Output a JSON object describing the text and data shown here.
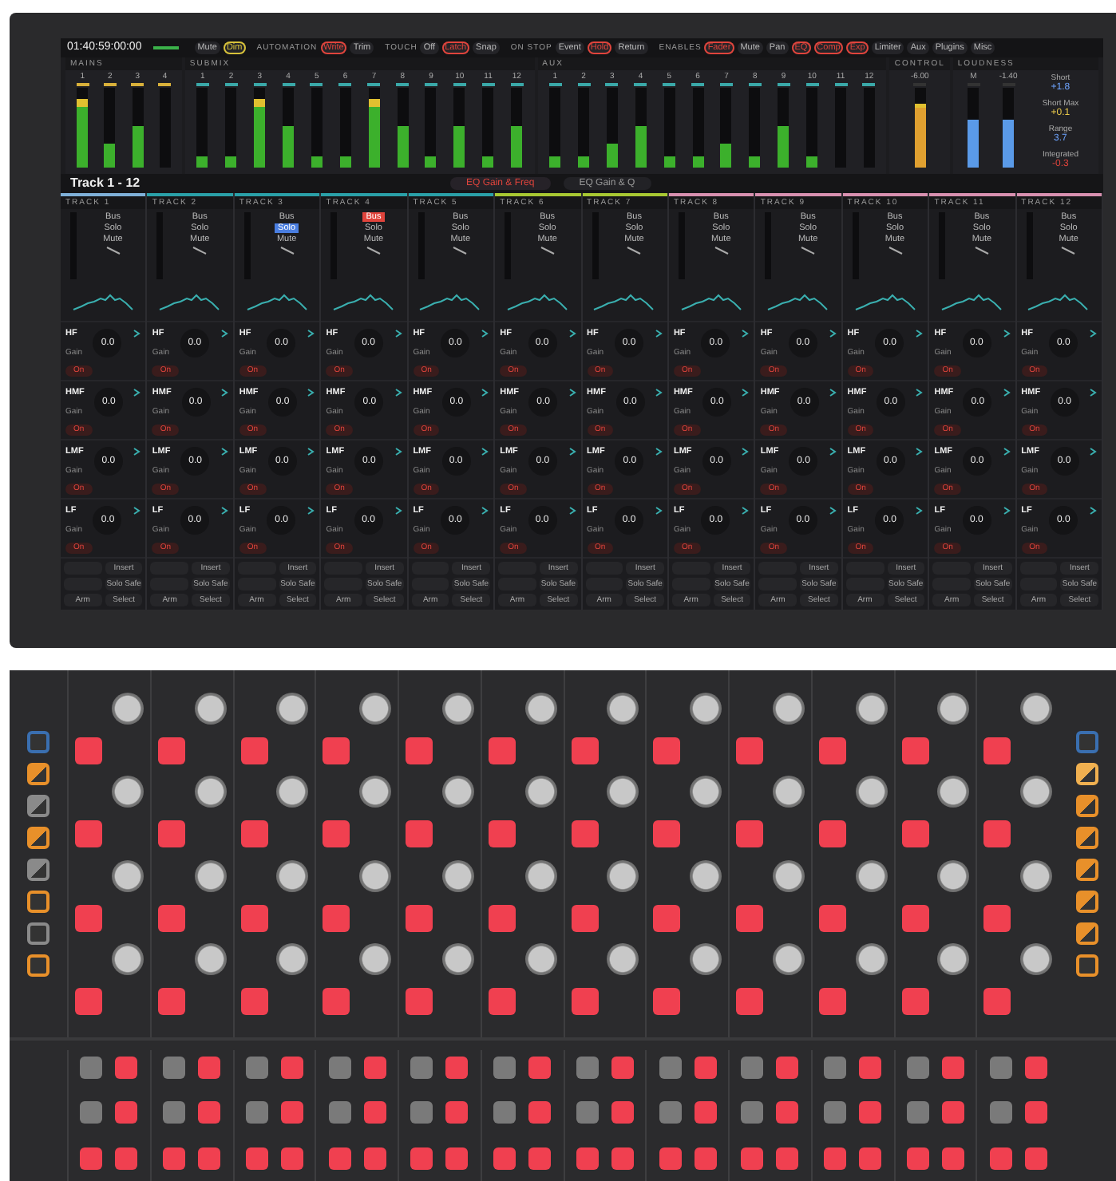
{
  "header": {
    "timecode": "01:40:59:00:00",
    "groups": [
      {
        "color": "#d8c23a",
        "options": [
          {
            "label": "Mute",
            "on": false
          },
          {
            "label": "Dim",
            "on": true
          }
        ]
      },
      {
        "title": "AUTOMATION",
        "color": "#e0443c",
        "options": [
          {
            "label": "Write",
            "on": true
          },
          {
            "label": "Trim",
            "on": false
          }
        ]
      },
      {
        "title": "TOUCH",
        "color": "#e0443c",
        "options": [
          {
            "label": "Off",
            "on": false
          },
          {
            "label": "Latch",
            "on": true
          },
          {
            "label": "Snap",
            "on": false
          }
        ]
      },
      {
        "title": "ON STOP",
        "color": "#e0443c",
        "options": [
          {
            "label": "Event",
            "on": false
          },
          {
            "label": "Hold",
            "on": true
          },
          {
            "label": "Return",
            "on": false
          }
        ]
      },
      {
        "title": "ENABLES",
        "color": "#e0443c",
        "options": [
          {
            "label": "Fader",
            "on": true
          },
          {
            "label": "Mute",
            "on": false
          },
          {
            "label": "Pan",
            "on": false
          },
          {
            "label": "EQ",
            "on": true
          },
          {
            "label": "Comp",
            "on": true
          },
          {
            "label": "Exp",
            "on": true
          },
          {
            "label": "Limiter",
            "on": false
          },
          {
            "label": "Aux",
            "on": false
          },
          {
            "label": "Plugins",
            "on": false
          },
          {
            "label": "Misc",
            "on": false
          }
        ]
      }
    ]
  },
  "meters": {
    "sections": [
      {
        "title": "MAINS",
        "color": "#d8b03a",
        "meters": [
          {
            "label": "1",
            "level": 0.85
          },
          {
            "label": "2",
            "level": 0.3
          },
          {
            "label": "3",
            "level": 0.52
          },
          {
            "label": "4",
            "level": 0.0
          }
        ]
      },
      {
        "title": "SUBMIX",
        "color": "#3aa8a8",
        "meters": [
          {
            "label": "1",
            "level": 0.13
          },
          {
            "label": "2",
            "level": 0.14
          },
          {
            "label": "3",
            "level": 0.85
          },
          {
            "label": "4",
            "level": 0.52
          },
          {
            "label": "5",
            "level": 0.13
          },
          {
            "label": "6",
            "level": 0.13
          },
          {
            "label": "7",
            "level": 0.85
          },
          {
            "label": "8",
            "level": 0.52
          },
          {
            "label": "9",
            "level": 0.13
          },
          {
            "label": "10",
            "level": 0.52
          },
          {
            "label": "11",
            "level": 0.13
          },
          {
            "label": "12",
            "level": 0.52
          }
        ]
      },
      {
        "title": "AUX",
        "color": "#3aa8a8",
        "meters": [
          {
            "label": "1",
            "level": 0.13
          },
          {
            "label": "2",
            "level": 0.13
          },
          {
            "label": "3",
            "level": 0.3
          },
          {
            "label": "4",
            "level": 0.52
          },
          {
            "label": "5",
            "level": 0.13
          },
          {
            "label": "6",
            "level": 0.13
          },
          {
            "label": "7",
            "level": 0.3
          },
          {
            "label": "8",
            "level": 0.13
          },
          {
            "label": "9",
            "level": 0.52
          },
          {
            "label": "10",
            "level": 0.13
          },
          {
            "label": "11",
            "level": 0.0
          },
          {
            "label": "12",
            "level": 0.0
          }
        ]
      }
    ],
    "control": {
      "title": "CONTROL",
      "label": "-6.00",
      "level": 0.8
    },
    "loudness": {
      "title": "LOUDNESS",
      "meters": [
        {
          "label": "M",
          "level": 0.6
        },
        {
          "label": "-1.40",
          "level": 0.6
        }
      ],
      "readings": [
        {
          "label": "Short",
          "value": "+1.8",
          "color": "#6ea4ff"
        },
        {
          "label": "Short Max",
          "value": "+0.1",
          "color": "#e8c84a"
        },
        {
          "label": "Range",
          "value": "3.7",
          "color": "#6ea4ff"
        },
        {
          "label": "Integrated",
          "value": "-0.3",
          "color": "#e0443c"
        }
      ]
    }
  },
  "bank": {
    "title": "Track 1 - 12",
    "tabs": [
      {
        "label": "EQ Gain & Freq",
        "selected": true
      },
      {
        "label": "EQ Gain & Q",
        "selected": false
      }
    ]
  },
  "tracks": [
    {
      "name": "TRACK 1",
      "color": "#7fb0d8",
      "buttons": [
        {
          "label": "Bus",
          "on": false
        },
        {
          "label": "Solo",
          "on": false
        },
        {
          "label": "Mute",
          "on": false
        }
      ],
      "bands": [
        {
          "name": "HF",
          "param": "Gain",
          "value": "0.0",
          "button": "On"
        },
        {
          "name": "HMF",
          "param": "Gain",
          "value": "0.0",
          "button": "On"
        },
        {
          "name": "LMF",
          "param": "Gain",
          "value": "0.0",
          "button": "On"
        },
        {
          "name": "LF",
          "param": "Gain",
          "value": "0.0",
          "button": "On"
        }
      ],
      "footer": [
        {
          "right": "Insert"
        },
        {
          "right": "Solo Safe"
        },
        {
          "left": "Arm",
          "right": "Select"
        }
      ]
    },
    {
      "name": "TRACK 2",
      "color": "#2aa0a8",
      "buttons": [
        {
          "label": "Bus",
          "on": false
        },
        {
          "label": "Solo",
          "on": false
        },
        {
          "label": "Mute",
          "on": false
        }
      ],
      "bands": [
        {
          "name": "HF",
          "param": "Gain",
          "value": "0.0",
          "button": "On"
        },
        {
          "name": "HMF",
          "param": "Gain",
          "value": "0.0",
          "button": "On"
        },
        {
          "name": "LMF",
          "param": "Gain",
          "value": "0.0",
          "button": "On"
        },
        {
          "name": "LF",
          "param": "Gain",
          "value": "0.0",
          "button": "On"
        }
      ],
      "footer": [
        {
          "right": "Insert"
        },
        {
          "right": "Solo Safe"
        },
        {
          "left": "Arm",
          "right": "Select"
        }
      ]
    },
    {
      "name": "TRACK 3",
      "color": "#2aa0a8",
      "buttons": [
        {
          "label": "Bus",
          "on": false
        },
        {
          "label": "Solo",
          "on": true
        },
        {
          "label": "Mute",
          "on": false
        }
      ],
      "bands": [
        {
          "name": "HF",
          "param": "Gain",
          "value": "0.0",
          "button": "On"
        },
        {
          "name": "HMF",
          "param": "Gain",
          "value": "0.0",
          "button": "On"
        },
        {
          "name": "LMF",
          "param": "Gain",
          "value": "0.0",
          "button": "On"
        },
        {
          "name": "LF",
          "param": "Gain",
          "value": "0.0",
          "button": "On"
        }
      ],
      "footer": [
        {
          "right": "Insert"
        },
        {
          "right": "Solo Safe"
        },
        {
          "left": "Arm",
          "right": "Select"
        }
      ]
    },
    {
      "name": "TRACK 4",
      "color": "#2aa0a8",
      "buttons": [
        {
          "label": "Bus",
          "on": true
        },
        {
          "label": "Solo",
          "on": false
        },
        {
          "label": "Mute",
          "on": false
        }
      ],
      "bands": [
        {
          "name": "HF",
          "param": "Gain",
          "value": "0.0",
          "button": "On"
        },
        {
          "name": "HMF",
          "param": "Gain",
          "value": "0.0",
          "button": "On"
        },
        {
          "name": "LMF",
          "param": "Gain",
          "value": "0.0",
          "button": "On"
        },
        {
          "name": "LF",
          "param": "Gain",
          "value": "0.0",
          "button": "On"
        }
      ],
      "footer": [
        {
          "right": "Insert"
        },
        {
          "right": "Solo Safe"
        },
        {
          "left": "Arm",
          "right": "Select"
        }
      ]
    },
    {
      "name": "TRACK 5",
      "color": "#2aa0a8",
      "buttons": [
        {
          "label": "Bus",
          "on": false
        },
        {
          "label": "Solo",
          "on": false
        },
        {
          "label": "Mute",
          "on": false
        }
      ],
      "bands": [
        {
          "name": "HF",
          "param": "Gain",
          "value": "0.0",
          "button": "On"
        },
        {
          "name": "HMF",
          "param": "Gain",
          "value": "0.0",
          "button": "On"
        },
        {
          "name": "LMF",
          "param": "Gain",
          "value": "0.0",
          "button": "On"
        },
        {
          "name": "LF",
          "param": "Gain",
          "value": "0.0",
          "button": "On"
        }
      ],
      "footer": [
        {
          "right": "Insert"
        },
        {
          "right": "Solo Safe"
        },
        {
          "left": "Arm",
          "right": "Select"
        }
      ]
    },
    {
      "name": "TRACK 6",
      "color": "#a8c832",
      "buttons": [
        {
          "label": "Bus",
          "on": false
        },
        {
          "label": "Solo",
          "on": false
        },
        {
          "label": "Mute",
          "on": false
        }
      ],
      "bands": [
        {
          "name": "HF",
          "param": "Gain",
          "value": "0.0",
          "button": "On"
        },
        {
          "name": "HMF",
          "param": "Gain",
          "value": "0.0",
          "button": "On"
        },
        {
          "name": "LMF",
          "param": "Gain",
          "value": "0.0",
          "button": "On"
        },
        {
          "name": "LF",
          "param": "Gain",
          "value": "0.0",
          "button": "On"
        }
      ],
      "footer": [
        {
          "right": "Insert"
        },
        {
          "right": "Solo Safe"
        },
        {
          "left": "Arm",
          "right": "Select"
        }
      ]
    },
    {
      "name": "TRACK 7",
      "color": "#a8c832",
      "buttons": [
        {
          "label": "Bus",
          "on": false
        },
        {
          "label": "Solo",
          "on": false
        },
        {
          "label": "Mute",
          "on": false
        }
      ],
      "bands": [
        {
          "name": "HF",
          "param": "Gain",
          "value": "0.0",
          "button": "On"
        },
        {
          "name": "HMF",
          "param": "Gain",
          "value": "0.0",
          "button": "On"
        },
        {
          "name": "LMF",
          "param": "Gain",
          "value": "0.0",
          "button": "On"
        },
        {
          "name": "LF",
          "param": "Gain",
          "value": "0.0",
          "button": "On"
        }
      ],
      "footer": [
        {
          "right": "Insert"
        },
        {
          "right": "Solo Safe"
        },
        {
          "left": "Arm",
          "right": "Select"
        }
      ]
    },
    {
      "name": "TRACK 8",
      "color": "#d890b0",
      "buttons": [
        {
          "label": "Bus",
          "on": false
        },
        {
          "label": "Solo",
          "on": false
        },
        {
          "label": "Mute",
          "on": false
        }
      ],
      "bands": [
        {
          "name": "HF",
          "param": "Gain",
          "value": "0.0",
          "button": "On"
        },
        {
          "name": "HMF",
          "param": "Gain",
          "value": "0.0",
          "button": "On"
        },
        {
          "name": "LMF",
          "param": "Gain",
          "value": "0.0",
          "button": "On"
        },
        {
          "name": "LF",
          "param": "Gain",
          "value": "0.0",
          "button": "On"
        }
      ],
      "footer": [
        {
          "right": "Insert"
        },
        {
          "right": "Solo Safe"
        },
        {
          "left": "Arm",
          "right": "Select"
        }
      ]
    },
    {
      "name": "TRACK 9",
      "color": "#d890b0",
      "buttons": [
        {
          "label": "Bus",
          "on": false
        },
        {
          "label": "Solo",
          "on": false
        },
        {
          "label": "Mute",
          "on": false
        }
      ],
      "bands": [
        {
          "name": "HF",
          "param": "Gain",
          "value": "0.0",
          "button": "On"
        },
        {
          "name": "HMF",
          "param": "Gain",
          "value": "0.0",
          "button": "On"
        },
        {
          "name": "LMF",
          "param": "Gain",
          "value": "0.0",
          "button": "On"
        },
        {
          "name": "LF",
          "param": "Gain",
          "value": "0.0",
          "button": "On"
        }
      ],
      "footer": [
        {
          "right": "Insert"
        },
        {
          "right": "Solo Safe"
        },
        {
          "left": "Arm",
          "right": "Select"
        }
      ]
    },
    {
      "name": "TRACK 10",
      "color": "#d890b0",
      "buttons": [
        {
          "label": "Bus",
          "on": false
        },
        {
          "label": "Solo",
          "on": false
        },
        {
          "label": "Mute",
          "on": false
        }
      ],
      "bands": [
        {
          "name": "HF",
          "param": "Gain",
          "value": "0.0",
          "button": "On"
        },
        {
          "name": "HMF",
          "param": "Gain",
          "value": "0.0",
          "button": "On"
        },
        {
          "name": "LMF",
          "param": "Gain",
          "value": "0.0",
          "button": "On"
        },
        {
          "name": "LF",
          "param": "Gain",
          "value": "0.0",
          "button": "On"
        }
      ],
      "footer": [
        {
          "right": "Insert"
        },
        {
          "right": "Solo Safe"
        },
        {
          "left": "Arm",
          "right": "Select"
        }
      ]
    },
    {
      "name": "TRACK 11",
      "color": "#d890b0",
      "buttons": [
        {
          "label": "Bus",
          "on": false
        },
        {
          "label": "Solo",
          "on": false
        },
        {
          "label": "Mute",
          "on": false
        }
      ],
      "bands": [
        {
          "name": "HF",
          "param": "Gain",
          "value": "0.0",
          "button": "On"
        },
        {
          "name": "HMF",
          "param": "Gain",
          "value": "0.0",
          "button": "On"
        },
        {
          "name": "LMF",
          "param": "Gain",
          "value": "0.0",
          "button": "On"
        },
        {
          "name": "LF",
          "param": "Gain",
          "value": "0.0",
          "button": "On"
        }
      ],
      "footer": [
        {
          "right": "Insert"
        },
        {
          "right": "Solo Safe"
        },
        {
          "left": "Arm",
          "right": "Select"
        }
      ]
    },
    {
      "name": "TRACK 12",
      "color": "#d890b0",
      "buttons": [
        {
          "label": "Bus",
          "on": false
        },
        {
          "label": "Solo",
          "on": false
        },
        {
          "label": "Mute",
          "on": false
        }
      ],
      "bands": [
        {
          "name": "HF",
          "param": "Gain",
          "value": "0.0",
          "button": "On"
        },
        {
          "name": "HMF",
          "param": "Gain",
          "value": "0.0",
          "button": "On"
        },
        {
          "name": "LMF",
          "param": "Gain",
          "value": "0.0",
          "button": "On"
        },
        {
          "name": "LF",
          "param": "Gain",
          "value": "0.0",
          "button": "On"
        }
      ],
      "footer": [
        {
          "right": "Insert"
        },
        {
          "right": "Solo Safe"
        },
        {
          "left": "Arm",
          "right": "Select"
        }
      ]
    }
  ],
  "surface": {
    "left_keys": [
      {
        "kind": "outline",
        "color": "#3a6fb0"
      },
      {
        "kind": "split",
        "color": "#e8902a"
      },
      {
        "kind": "split",
        "color": "#8a8a8a"
      },
      {
        "kind": "split",
        "color": "#e8902a"
      },
      {
        "kind": "split",
        "color": "#8a8a8a"
      },
      {
        "kind": "outline",
        "color": "#e8902a"
      },
      {
        "kind": "outline",
        "color": "#8a8a8a"
      },
      {
        "kind": "outline",
        "color": "#e8902a"
      }
    ],
    "right_keys": [
      {
        "kind": "outline",
        "color": "#3a6fb0"
      },
      {
        "kind": "split",
        "color": "#f0b050"
      },
      {
        "kind": "split",
        "color": "#e8902a"
      },
      {
        "kind": "split",
        "color": "#e8902a"
      },
      {
        "kind": "split",
        "color": "#e8902a"
      },
      {
        "kind": "split",
        "color": "#e8902a"
      },
      {
        "kind": "split",
        "color": "#e8902a"
      },
      {
        "kind": "outline",
        "color": "#e8902a"
      }
    ],
    "strips": [
      {
        "keys": [
          {
            "lit": true
          },
          {
            "lit": true
          },
          {
            "lit": true
          },
          {
            "lit": true
          }
        ],
        "bottom_keys": [
          {
            "lit": false
          },
          {
            "lit": true
          },
          {
            "lit": false
          },
          {
            "lit": true
          },
          {
            "lit": true
          },
          {
            "lit": true
          }
        ]
      },
      {
        "keys": [
          {
            "lit": true
          },
          {
            "lit": true
          },
          {
            "lit": true
          },
          {
            "lit": true
          }
        ],
        "bottom_keys": [
          {
            "lit": false
          },
          {
            "lit": true
          },
          {
            "lit": false
          },
          {
            "lit": true
          },
          {
            "lit": true
          },
          {
            "lit": true
          }
        ]
      },
      {
        "keys": [
          {
            "lit": true
          },
          {
            "lit": true
          },
          {
            "lit": true
          },
          {
            "lit": true
          }
        ],
        "bottom_keys": [
          {
            "lit": false
          },
          {
            "lit": true
          },
          {
            "lit": false
          },
          {
            "lit": true
          },
          {
            "lit": true
          },
          {
            "lit": true
          }
        ]
      },
      {
        "keys": [
          {
            "lit": true
          },
          {
            "lit": true
          },
          {
            "lit": true
          },
          {
            "lit": true
          }
        ],
        "bottom_keys": [
          {
            "lit": false
          },
          {
            "lit": true
          },
          {
            "lit": false
          },
          {
            "lit": true
          },
          {
            "lit": true
          },
          {
            "lit": true
          }
        ]
      },
      {
        "keys": [
          {
            "lit": true
          },
          {
            "lit": true
          },
          {
            "lit": true
          },
          {
            "lit": true
          }
        ],
        "bottom_keys": [
          {
            "lit": false
          },
          {
            "lit": true
          },
          {
            "lit": false
          },
          {
            "lit": true
          },
          {
            "lit": true
          },
          {
            "lit": true
          }
        ]
      },
      {
        "keys": [
          {
            "lit": true
          },
          {
            "lit": true
          },
          {
            "lit": true
          },
          {
            "lit": true
          }
        ],
        "bottom_keys": [
          {
            "lit": false
          },
          {
            "lit": true
          },
          {
            "lit": false
          },
          {
            "lit": true
          },
          {
            "lit": true
          },
          {
            "lit": true
          }
        ]
      },
      {
        "keys": [
          {
            "lit": true
          },
          {
            "lit": true
          },
          {
            "lit": true
          },
          {
            "lit": true
          }
        ],
        "bottom_keys": [
          {
            "lit": false
          },
          {
            "lit": true
          },
          {
            "lit": false
          },
          {
            "lit": true
          },
          {
            "lit": true
          },
          {
            "lit": true
          }
        ]
      },
      {
        "keys": [
          {
            "lit": true
          },
          {
            "lit": true
          },
          {
            "lit": true
          },
          {
            "lit": true
          }
        ],
        "bottom_keys": [
          {
            "lit": false
          },
          {
            "lit": true
          },
          {
            "lit": false
          },
          {
            "lit": true
          },
          {
            "lit": true
          },
          {
            "lit": true
          }
        ]
      },
      {
        "keys": [
          {
            "lit": true
          },
          {
            "lit": true
          },
          {
            "lit": true
          },
          {
            "lit": true
          }
        ],
        "bottom_keys": [
          {
            "lit": false
          },
          {
            "lit": true
          },
          {
            "lit": false
          },
          {
            "lit": true
          },
          {
            "lit": true
          },
          {
            "lit": true
          }
        ]
      },
      {
        "keys": [
          {
            "lit": true
          },
          {
            "lit": true
          },
          {
            "lit": true
          },
          {
            "lit": true
          }
        ],
        "bottom_keys": [
          {
            "lit": false
          },
          {
            "lit": true
          },
          {
            "lit": false
          },
          {
            "lit": true
          },
          {
            "lit": true
          },
          {
            "lit": true
          }
        ]
      },
      {
        "keys": [
          {
            "lit": true
          },
          {
            "lit": true
          },
          {
            "lit": true
          },
          {
            "lit": true
          }
        ],
        "bottom_keys": [
          {
            "lit": false
          },
          {
            "lit": true
          },
          {
            "lit": false
          },
          {
            "lit": true
          },
          {
            "lit": true
          },
          {
            "lit": true
          }
        ]
      },
      {
        "keys": [
          {
            "lit": true
          },
          {
            "lit": true
          },
          {
            "lit": true
          },
          {
            "lit": true
          }
        ],
        "bottom_keys": [
          {
            "lit": false
          },
          {
            "lit": true
          },
          {
            "lit": false
          },
          {
            "lit": true
          },
          {
            "lit": true
          },
          {
            "lit": true
          }
        ]
      }
    ]
  }
}
